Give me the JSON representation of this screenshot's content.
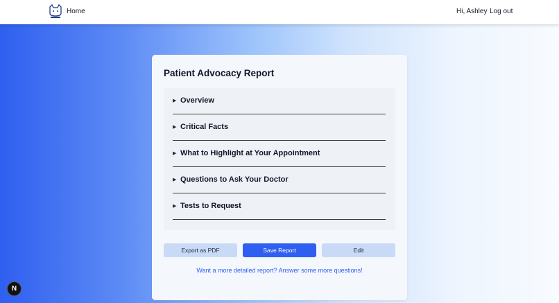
{
  "nav": {
    "logo_icon": "cat-logo-icon",
    "home_label": "Home",
    "greeting": "Hi, Ashley",
    "logout_label": "Log out"
  },
  "report": {
    "title": "Patient Advocacy Report",
    "sections": [
      {
        "label": "Overview"
      },
      {
        "label": "Critical Facts"
      },
      {
        "label": "What to Highlight at Your Appointment"
      },
      {
        "label": "Questions to Ask Your Doctor"
      },
      {
        "label": "Tests to Request"
      }
    ],
    "arrow_glyph": "▶",
    "buttons": {
      "export_pdf": "Export as PDF",
      "save": "Save Report",
      "edit": "Edit"
    },
    "more_link": "Want a more detailed report? Answer some more questions!"
  },
  "badge": {
    "letter": "N",
    "icon": "nextjs-badge-icon"
  },
  "colors": {
    "primary": "#2f5ff0",
    "button_light": "#c9daf6",
    "card_bg": "#f4f7fc"
  }
}
